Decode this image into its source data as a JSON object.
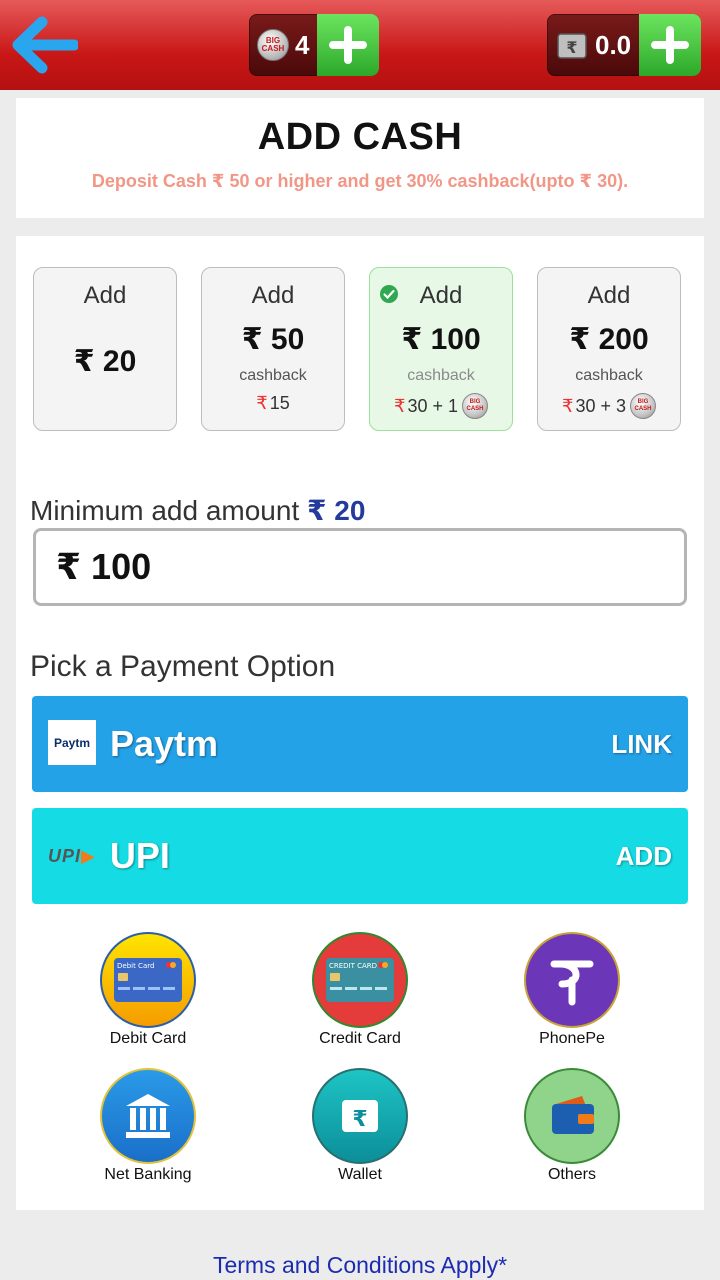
{
  "header": {
    "big_cash_count": "4",
    "wallet_balance": "0.0",
    "coin_label": "BIG CASH"
  },
  "title": {
    "heading": "ADD CASH",
    "promo": "Deposit Cash ₹ 50 or higher and get 30% cashback(upto ₹ 30)."
  },
  "amount_options": [
    {
      "add_label": "Add",
      "amount": "₹ 20",
      "cashback_label": "",
      "bonus": ""
    },
    {
      "add_label": "Add",
      "amount": "₹ 50",
      "cashback_label": "cashback",
      "bonus_rs": "₹",
      "bonus": "15"
    },
    {
      "add_label": "Add",
      "amount": "₹ 100",
      "cashback_label": "cashback",
      "bonus_rs": "₹",
      "bonus": "30 + 1",
      "selected": true
    },
    {
      "add_label": "Add",
      "amount": "₹ 200",
      "cashback_label": "cashback",
      "bonus_rs": "₹",
      "bonus": "30 + 3"
    }
  ],
  "minimum": {
    "label": "Minimum add amount",
    "value": "₹ 20"
  },
  "amount_input": {
    "value": "₹ 100"
  },
  "payment": {
    "label": "Pick a Payment Option",
    "paytm": {
      "logo": "Paytm",
      "name": "Paytm",
      "action": "LINK"
    },
    "upi": {
      "logo": "UPI",
      "name": "UPI",
      "action": "ADD"
    },
    "options": [
      {
        "label": "Debit Card",
        "card_text": "Debit Card"
      },
      {
        "label": "Credit Card",
        "card_text": "CREDIT CARD"
      },
      {
        "label": "PhonePe"
      },
      {
        "label": "Net Banking"
      },
      {
        "label": "Wallet"
      },
      {
        "label": "Others"
      }
    ]
  },
  "footer": {
    "terms": "Terms and Conditions Apply*"
  },
  "colors": {
    "header_red": "#c91717",
    "paytm_blue": "#23a2e8",
    "upi_cyan": "#15dce4",
    "plus_green": "#2ea82a",
    "promo_text": "#f29686",
    "terms_link": "#1c2cb0"
  }
}
